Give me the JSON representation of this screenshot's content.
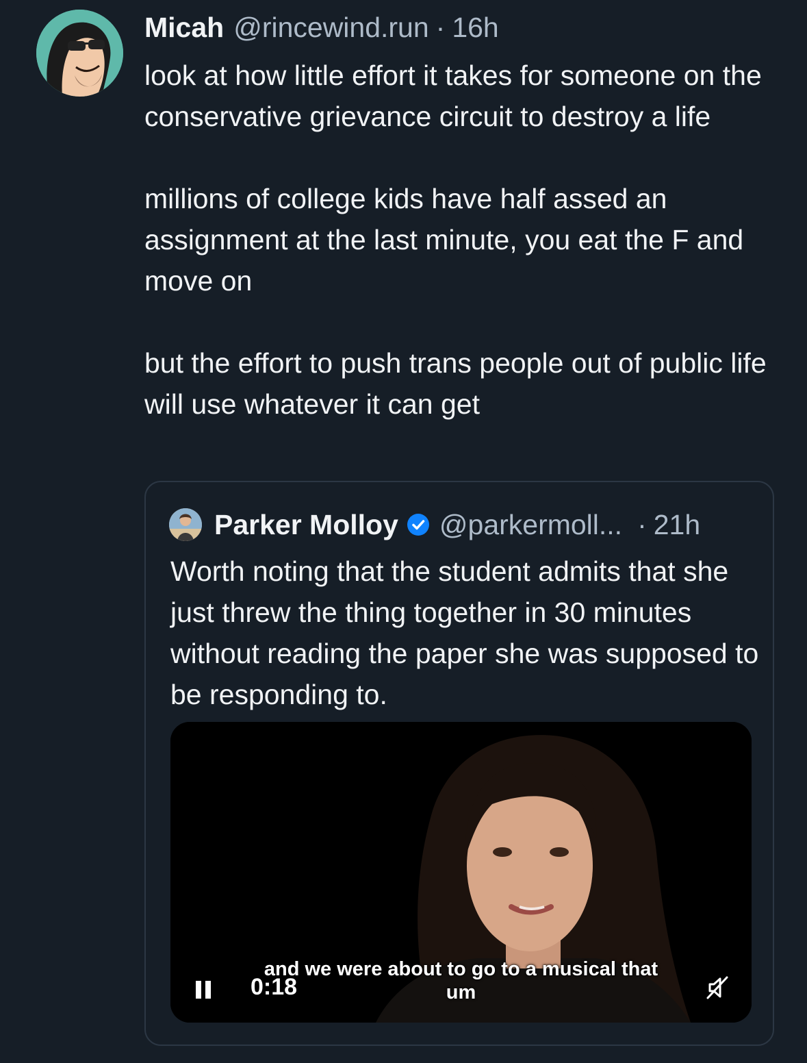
{
  "post": {
    "author": {
      "display_name": "Micah",
      "handle": "@rincewind.run",
      "separator": "·",
      "time": "16h",
      "avatar_icon": "cartoon-avatar-icon"
    },
    "paragraphs": [
      "look at how little effort it takes for someone on the conservative grievance circuit to destroy a life",
      "millions of college kids have half assed an assignment at the last minute, you eat the F and move on",
      "but the effort to push trans people out of public life will use whatever it can get"
    ]
  },
  "quote": {
    "author": {
      "display_name": "Parker Molloy",
      "handle": "@parkermoll...",
      "separator": "·",
      "time": "21h",
      "verified_icon": "verified-badge-icon",
      "avatar_icon": "profile-photo-icon"
    },
    "text": "Worth noting that the student admits that she just threw the thing together in 30 minutes without reading the paper she was supposed to be responding to.",
    "video": {
      "subtitle_line1": "and we were about to go to a musical that",
      "subtitle_line2": "um",
      "time": "0:18",
      "pause_icon": "pause-icon",
      "mute_icon": "muted-speaker-icon"
    }
  },
  "colors": {
    "background": "#161e27",
    "text": "#f1f3f5",
    "muted_text": "#aebbc9",
    "border": "#2c3744",
    "verified": "#1083fe"
  }
}
